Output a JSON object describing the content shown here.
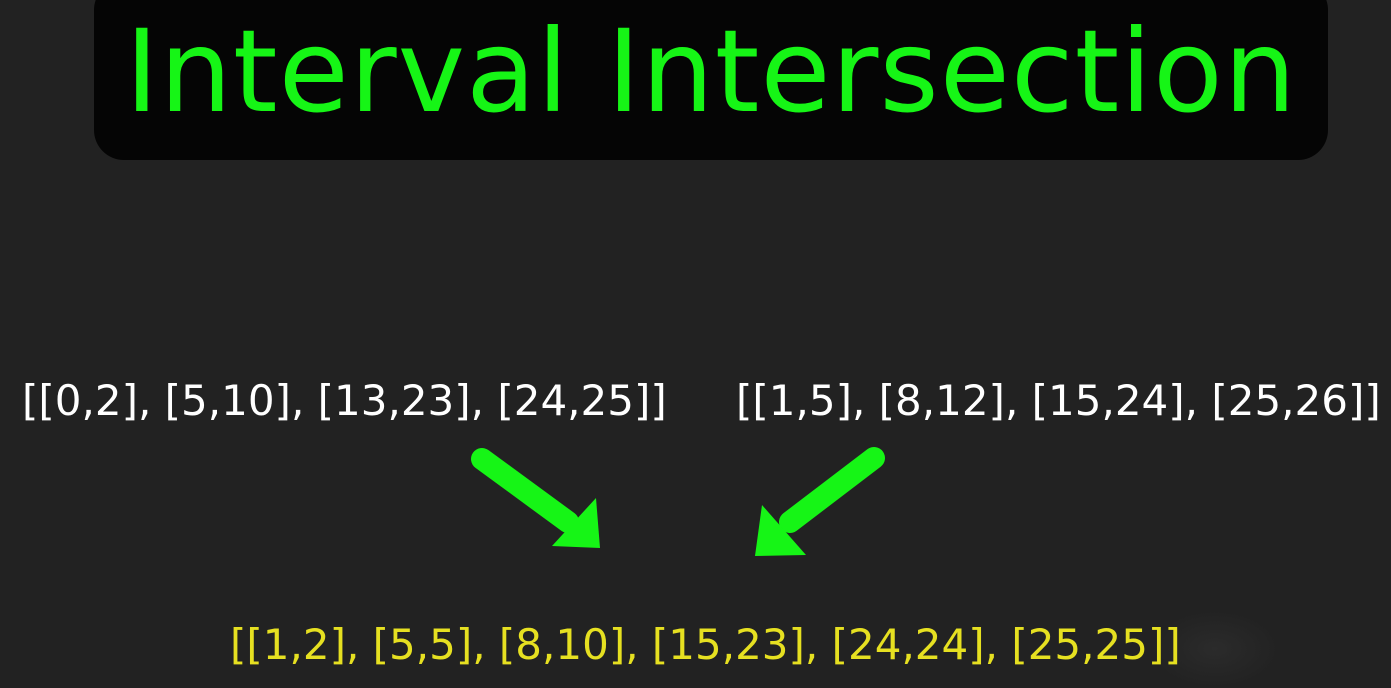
{
  "title": "Interval Intersection",
  "first_list": "[[0,2], [5,10], [13,23], [24,25]]",
  "second_list": "[[1,5], [8,12], [15,24], [25,26]]",
  "result_list": "[[1,2], [5,5], [8,10], [15,23], [24,24], [25,25]]",
  "colors": {
    "background": "#222222",
    "title_box": "#050505",
    "title_text": "#16f516",
    "input_text": "#ffffff",
    "result_text": "#e6e021",
    "arrow": "#16f516"
  }
}
